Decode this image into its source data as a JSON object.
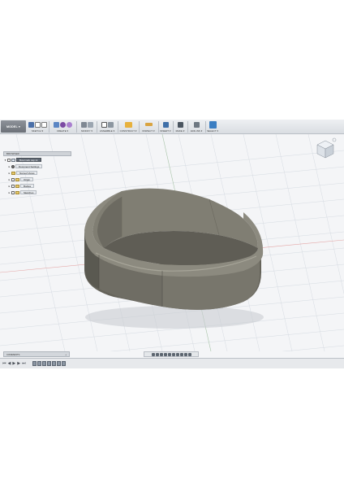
{
  "toolbar": {
    "mode": "MODEL ▾",
    "groups": [
      {
        "label": "SKETCH ▾",
        "icons": [
          "sketch-icon",
          "undo-sketch-icon",
          "line-icon"
        ]
      },
      {
        "label": "CREATE ▾",
        "icons": [
          "box-icon",
          "cylinder-icon",
          "sphere-icon"
        ]
      },
      {
        "label": "MODIFY ▾",
        "icons": [
          "press-pull-icon",
          "fillet-icon"
        ]
      },
      {
        "label": "ASSEMBLE ▾",
        "icons": [
          "component-icon",
          "joint-icon"
        ]
      },
      {
        "label": "CONSTRUCT ▾",
        "icons": [
          "plane-icon"
        ]
      },
      {
        "label": "INSPECT ▾",
        "icons": [
          "measure-icon"
        ]
      },
      {
        "label": "INSERT ▾",
        "icons": [
          "insert-image-icon"
        ]
      },
      {
        "label": "MAKE ▾",
        "icons": [
          "3d-print-icon"
        ]
      },
      {
        "label": "ADD-INS ▾",
        "icons": [
          "scripts-icon"
        ]
      },
      {
        "label": "SELECT ▾",
        "icons": [
          "select-arrow-icon"
        ]
      }
    ]
  },
  "browser": {
    "title": "BROWSER",
    "root": "Bowl rack cap v1",
    "nodes": [
      "Document Settings",
      "Named Views",
      "Origin",
      "Bodies",
      "Sketches"
    ]
  },
  "comments": {
    "label": "COMMENTS",
    "icon": "plus-icon"
  },
  "colors": {
    "body": "#6e6c62",
    "body_dark": "#4f4e47",
    "body_light": "#8d8b80",
    "grid": "#d8dde4",
    "background": "#f4f5f7"
  }
}
